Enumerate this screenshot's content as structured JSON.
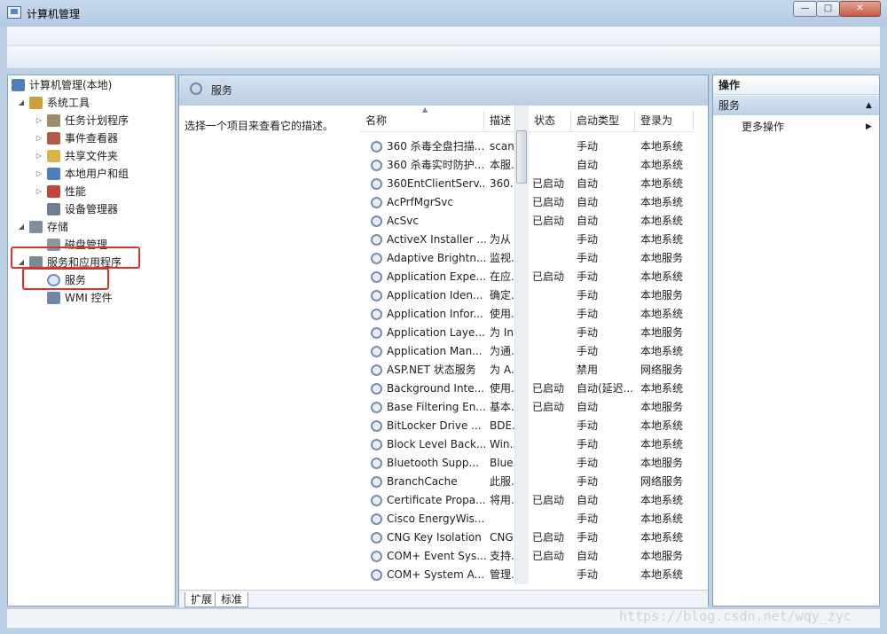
{
  "window": {
    "title": "计算机管理",
    "min_icon": "—",
    "max_icon": "□",
    "close_icon": "✕"
  },
  "tree": {
    "items": [
      {
        "label": "计算机管理(本地)",
        "icon": "computer-icon",
        "arrow": "",
        "level": 0
      },
      {
        "label": "系统工具",
        "icon": "tools-icon",
        "arrow": "◢",
        "level": 1
      },
      {
        "label": "任务计划程序",
        "icon": "clock-icon",
        "arrow": "▷",
        "level": 2
      },
      {
        "label": "事件查看器",
        "icon": "event-viewer-icon",
        "arrow": "▷",
        "level": 2
      },
      {
        "label": "共享文件夹",
        "icon": "shared-folder-icon",
        "arrow": "▷",
        "level": 2
      },
      {
        "label": "本地用户和组",
        "icon": "users-icon",
        "arrow": "▷",
        "level": 2
      },
      {
        "label": "性能",
        "icon": "performance-icon",
        "arrow": "▷",
        "level": 2
      },
      {
        "label": "设备管理器",
        "icon": "device-manager-icon",
        "arrow": "",
        "level": 2
      },
      {
        "label": "存储",
        "icon": "storage-icon",
        "arrow": "◢",
        "level": 1
      },
      {
        "label": "磁盘管理",
        "icon": "disk-icon",
        "arrow": "",
        "level": 2
      },
      {
        "label": "服务和应用程序",
        "icon": "services-apps-icon",
        "arrow": "◢",
        "level": 1
      },
      {
        "label": "服务",
        "icon": "gear-icon",
        "arrow": "",
        "level": 2
      },
      {
        "label": "WMI 控件",
        "icon": "wmi-icon",
        "arrow": "",
        "level": 2
      }
    ]
  },
  "main": {
    "title": "服务",
    "description": "选择一个项目来查看它的描述。",
    "columns": [
      "名称",
      "描述",
      "状态",
      "启动类型",
      "登录为"
    ],
    "sort_indicator": "▲",
    "rows": [
      [
        "360 杀毒全盘扫描...",
        "scan",
        "",
        "手动",
        "本地系统"
      ],
      [
        "360 杀毒实时防护...",
        "本服...",
        "",
        "自动",
        "本地系统"
      ],
      [
        "360EntClientServ...",
        "360...",
        "已启动",
        "自动",
        "本地系统"
      ],
      [
        "AcPrfMgrSvc",
        "",
        "已启动",
        "自动",
        "本地系统"
      ],
      [
        "AcSvc",
        "",
        "已启动",
        "自动",
        "本地系统"
      ],
      [
        "ActiveX Installer ...",
        "为从 ...",
        "",
        "手动",
        "本地系统"
      ],
      [
        "Adaptive Brightn...",
        "监视...",
        "",
        "手动",
        "本地服务"
      ],
      [
        "Application Expe...",
        "在应...",
        "已启动",
        "手动",
        "本地系统"
      ],
      [
        "Application Iden...",
        "确定...",
        "",
        "手动",
        "本地服务"
      ],
      [
        "Application Infor...",
        "使用...",
        "",
        "手动",
        "本地系统"
      ],
      [
        "Application Laye...",
        "为 In...",
        "",
        "手动",
        "本地服务"
      ],
      [
        "Application Man...",
        "为通...",
        "",
        "手动",
        "本地系统"
      ],
      [
        "ASP.NET 状态服务",
        "为 A...",
        "",
        "禁用",
        "网络服务"
      ],
      [
        "Background Inte...",
        "使用...",
        "已启动",
        "自动(延迟...",
        "本地系统"
      ],
      [
        "Base Filtering En...",
        "基本...",
        "已启动",
        "自动",
        "本地服务"
      ],
      [
        "BitLocker Drive ...",
        "BDE...",
        "",
        "手动",
        "本地系统"
      ],
      [
        "Block Level Back...",
        "Win...",
        "",
        "手动",
        "本地系统"
      ],
      [
        "Bluetooth Supp...",
        "Blue...",
        "",
        "手动",
        "本地服务"
      ],
      [
        "BranchCache",
        "此服...",
        "",
        "手动",
        "网络服务"
      ],
      [
        "Certificate Propa...",
        "将用...",
        "已启动",
        "自动",
        "本地系统"
      ],
      [
        "Cisco EnergyWis...",
        "",
        "",
        "手动",
        "本地系统"
      ],
      [
        "CNG Key Isolation",
        "CNG...",
        "已启动",
        "手动",
        "本地系统"
      ],
      [
        "COM+ Event Sys...",
        "支持...",
        "已启动",
        "自动",
        "本地服务"
      ],
      [
        "COM+ System A...",
        "管理...",
        "",
        "手动",
        "本地系统"
      ]
    ],
    "tabs": [
      "扩展",
      "标准"
    ]
  },
  "actions": {
    "header": "操作",
    "group": "服务",
    "collapse_icon": "▲",
    "more": "更多操作",
    "more_arrow": "▶"
  },
  "watermark": "https://blog.csdn.net/wqy_zyc"
}
